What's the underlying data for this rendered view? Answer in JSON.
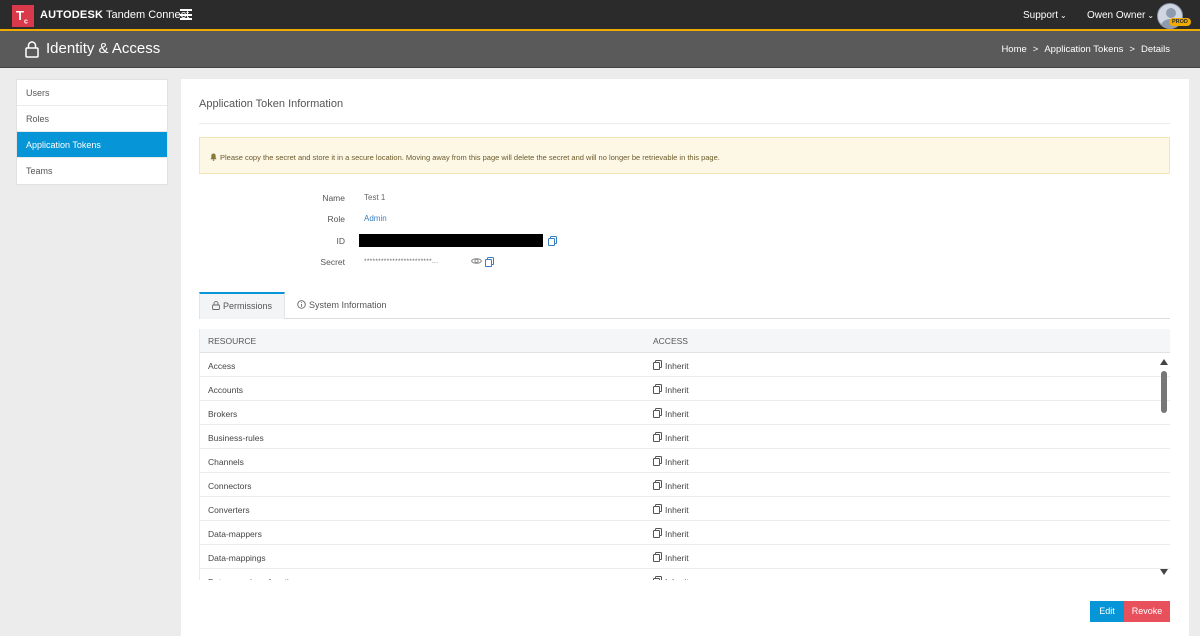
{
  "topbar": {
    "logo_text": "T",
    "logo_sub": "c",
    "brand_bold": "AUTODESK",
    "brand_product": "Tandem Connect",
    "support_label": "Support",
    "user_label": "Owen Owner",
    "env_badge": "PROD",
    "accent_color": "#f0ab00"
  },
  "header": {
    "title": "Identity & Access",
    "breadcrumb": [
      "Home",
      "Application Tokens",
      "Details"
    ]
  },
  "sidebar": {
    "items": [
      {
        "label": "Users",
        "active": false
      },
      {
        "label": "Roles",
        "active": false
      },
      {
        "label": "Application Tokens",
        "active": true
      },
      {
        "label": "Teams",
        "active": false
      }
    ],
    "active_color": "#0696d7"
  },
  "panel": {
    "title": "Application Token Information",
    "alert": "Please copy the secret and store it in a secure location. Moving away from this page will delete the secret and will no longer be retrievable in this page.",
    "fields": {
      "name_label": "Name",
      "name_value": "Test 1",
      "role_label": "Role",
      "role_value": "Admin",
      "id_label": "ID",
      "secret_label": "Secret",
      "secret_value": "************************..."
    }
  },
  "tabs": [
    {
      "label": "Permissions",
      "icon": "lock-icon",
      "active": true
    },
    {
      "label": "System Information",
      "icon": "info-icon",
      "active": false
    }
  ],
  "table": {
    "headers": [
      "RESOURCE",
      "ACCESS"
    ],
    "rows": [
      {
        "resource": "Access",
        "access": "Inherit"
      },
      {
        "resource": "Accounts",
        "access": "Inherit"
      },
      {
        "resource": "Brokers",
        "access": "Inherit"
      },
      {
        "resource": "Business-rules",
        "access": "Inherit"
      },
      {
        "resource": "Channels",
        "access": "Inherit"
      },
      {
        "resource": "Connectors",
        "access": "Inherit"
      },
      {
        "resource": "Converters",
        "access": "Inherit"
      },
      {
        "resource": "Data-mappers",
        "access": "Inherit"
      },
      {
        "resource": "Data-mappings",
        "access": "Inherit"
      },
      {
        "resource": "Data-mappings-functions",
        "access": "Inherit"
      }
    ]
  },
  "actions": {
    "edit_label": "Edit",
    "revoke_label": "Revoke",
    "edit_color": "#0696d7",
    "revoke_color": "#e8505b"
  }
}
